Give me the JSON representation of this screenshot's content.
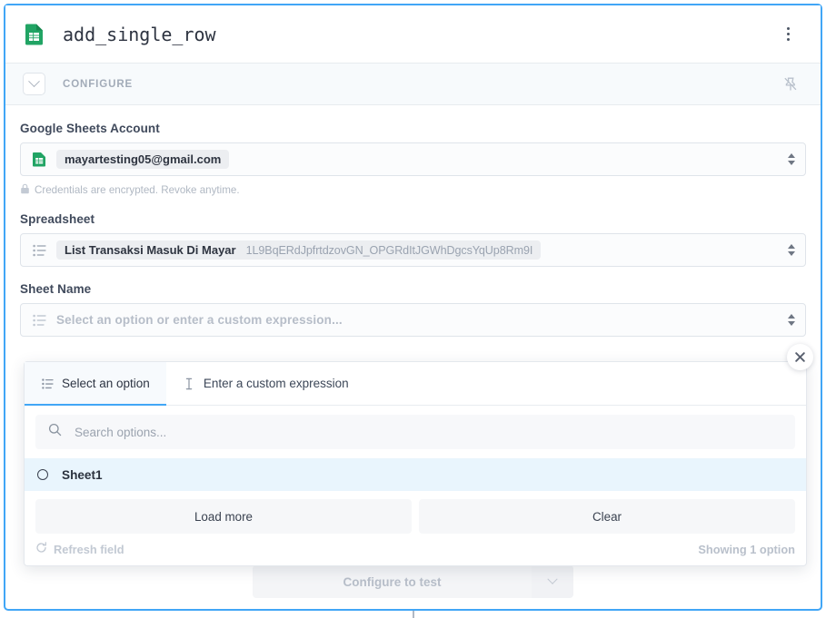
{
  "node": {
    "title": "add_single_row",
    "icon": "google-sheets-icon",
    "menu_icon": "kebab-menu-icon"
  },
  "configure_bar": {
    "label": "CONFIGURE",
    "collapse_icon": "chevron-down-icon",
    "pin_icon": "pin-off-icon"
  },
  "form": {
    "account": {
      "label": "Google Sheets Account",
      "lead_icon": "google-sheets-icon",
      "value": "mayartesting05@gmail.com",
      "stepper_icon": "select-stepper-icon",
      "note": "Credentials are encrypted. Revoke anytime.",
      "note_icon": "lock-icon"
    },
    "spreadsheet": {
      "label": "Spreadsheet",
      "lead_icon": "list-icon",
      "value": "List Transaksi Masuk Di Mayar",
      "value_id": "1L9BqERdJpfrtdzovGN_OPGRdItJGWhDgcsYqUp8Rm9I",
      "stepper_icon": "select-stepper-icon"
    },
    "sheet_name": {
      "label": "Sheet Name",
      "lead_icon": "list-icon",
      "placeholder": "Select an option or enter a custom expression...",
      "stepper_icon": "select-stepper-icon"
    }
  },
  "dropdown": {
    "tabs": [
      {
        "label": "Select an option",
        "icon": "list-icon",
        "active": true
      },
      {
        "label": "Enter a custom expression",
        "icon": "text-cursor-icon",
        "active": false
      }
    ],
    "search_placeholder": "Search options...",
    "search_icon": "search-icon",
    "options": [
      {
        "label": "Sheet1",
        "selected": false,
        "radio_icon": "radio-circle-icon"
      }
    ],
    "load_more_label": "Load more",
    "clear_label": "Clear",
    "refresh_label": "Refresh field",
    "refresh_icon": "refresh-icon",
    "showing_text": "Showing 1 option",
    "close_icon": "close-icon"
  },
  "footer": {
    "test_label": "Configure to test",
    "caret_icon": "chevron-down-icon"
  },
  "colors": {
    "accent": "#41a6f6",
    "google_sheets_green": "#21a464",
    "option_highlight": "#e9f5fd",
    "chip_bg": "#eceef1"
  }
}
